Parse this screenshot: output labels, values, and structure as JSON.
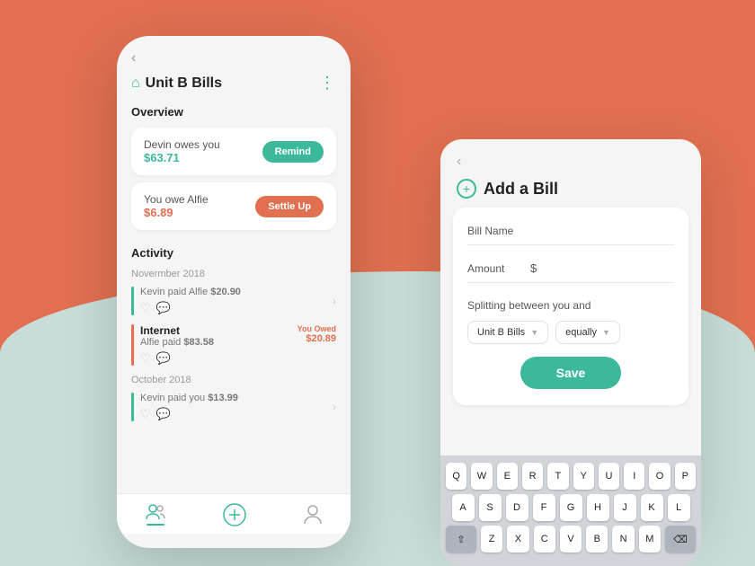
{
  "background": {
    "top_color": "#e07050",
    "bottom_color": "#c8ddd8"
  },
  "left_phone": {
    "back_arrow": "‹",
    "header": {
      "title": "Unit B Bills",
      "menu_icon": "⋮"
    },
    "overview": {
      "label": "Overview",
      "card1": {
        "text": "Devin owes you",
        "amount": "$63.71",
        "button_label": "Remind"
      },
      "card2": {
        "text": "You owe Alfie",
        "amount": "$6.89",
        "button_label": "Settle Up"
      }
    },
    "activity": {
      "label": "Activity",
      "month1": {
        "label": "Novermber 2018",
        "items": [
          {
            "title": "Kevin paid Alfie",
            "amount": "$20.90",
            "you_owed": null,
            "you_owed_amount": null
          }
        ]
      },
      "month2_item": {
        "title": "Internet",
        "subtitle": "Alfie paid",
        "amount": "$83.58",
        "you_owed_label": "You Owed",
        "you_owed_amount": "$20.89"
      },
      "month3": {
        "label": "October 2018",
        "items": [
          {
            "title": "Kevin paid you",
            "amount": "$13.99"
          }
        ]
      }
    },
    "nav": {
      "group_icon": "👥",
      "add_icon": "+",
      "profile_icon": "👤"
    }
  },
  "right_panel": {
    "back_arrow": "‹",
    "title": "Add a Bill",
    "form": {
      "bill_name_label": "Bill Name",
      "bill_name_placeholder": "",
      "amount_label": "Amount",
      "amount_dollar": "$",
      "amount_placeholder": "",
      "splitting_label": "Splitting between you and",
      "split_option1": "Unit B Bills",
      "split_option2": "equally",
      "save_button": "Save"
    }
  },
  "keyboard": {
    "rows": [
      [
        "Q",
        "W",
        "E",
        "R",
        "T",
        "Y",
        "U",
        "I",
        "O",
        "P"
      ],
      [
        "A",
        "S",
        "D",
        "F",
        "G",
        "H",
        "J",
        "K",
        "L"
      ],
      [
        "⇧",
        "Z",
        "X",
        "C",
        "V",
        "B",
        "N",
        "M",
        "⌫"
      ]
    ]
  }
}
